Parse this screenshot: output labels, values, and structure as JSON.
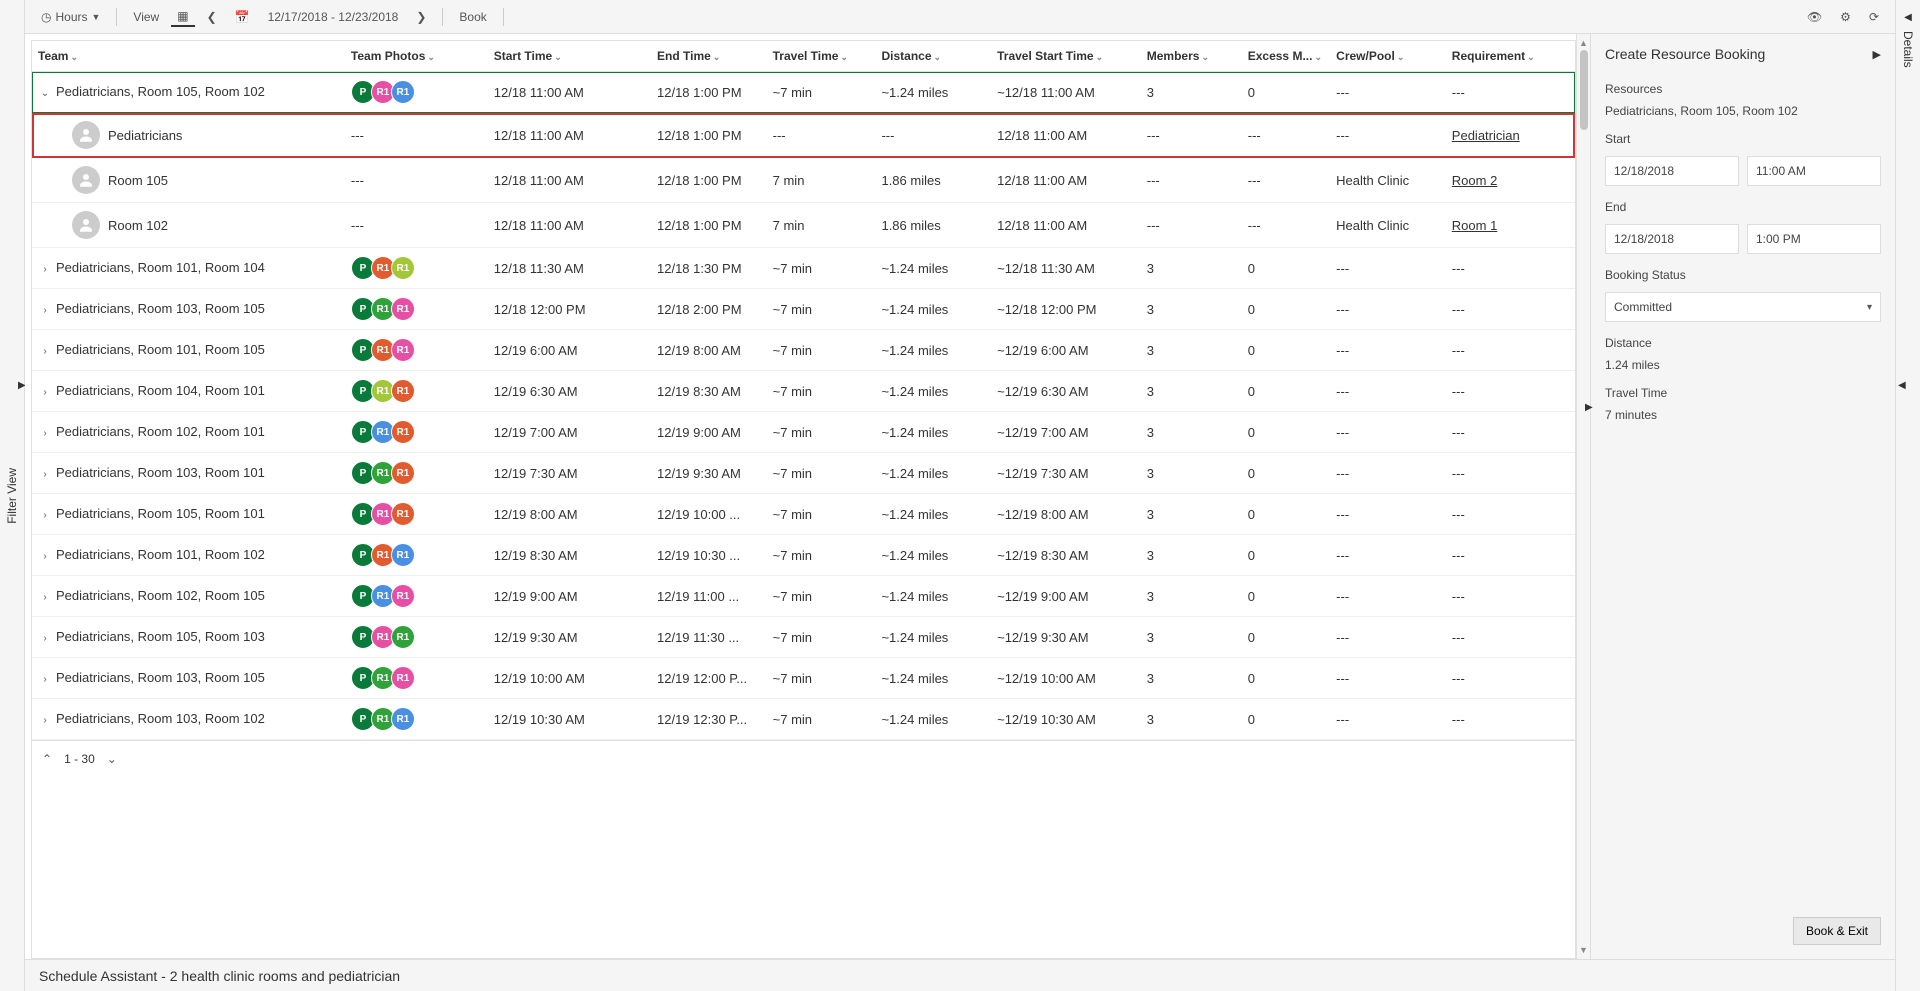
{
  "leftRailLabel": "Filter View",
  "rightRailLabel": "Details",
  "toolbar": {
    "hours": "Hours",
    "view": "View",
    "dateRange": "12/17/2018 - 12/23/2018",
    "book": "Book"
  },
  "columns": {
    "team": "Team",
    "photos": "Team Photos",
    "start": "Start Time",
    "end": "End Time",
    "travel": "Travel Time",
    "distance": "Distance",
    "travelStart": "Travel Start Time",
    "members": "Members",
    "excess": "Excess M...",
    "crew": "Crew/Pool",
    "requirement": "Requirement"
  },
  "rows": [
    {
      "expanded": true,
      "team": "Pediatricians, Room 105, Room 102",
      "photos": [
        {
          "t": "P",
          "c": "p-darkgreen"
        },
        {
          "t": "R1",
          "c": "r-pink"
        },
        {
          "t": "R1",
          "c": "r-blue"
        }
      ],
      "start": "12/18 11:00 AM",
      "end": "12/18 1:00 PM",
      "travel": "~7 min",
      "distance": "~1.24 miles",
      "travelStart": "~12/18 11:00 AM",
      "members": "3",
      "excess": "0",
      "crew": "---",
      "req": "---",
      "selected": true
    },
    {
      "child": true,
      "highlight": true,
      "team": "Pediatricians",
      "start": "12/18 11:00 AM",
      "end": "12/18 1:00 PM",
      "travel": "---",
      "distance": "---",
      "travelStart": "12/18 11:00 AM",
      "members": "---",
      "excess": "---",
      "crew": "---",
      "req": "Pediatrician",
      "reqLink": true,
      "photosText": "---"
    },
    {
      "child": true,
      "team": "Room 105",
      "start": "12/18 11:00 AM",
      "end": "12/18 1:00 PM",
      "travel": "7 min",
      "distance": "1.86 miles",
      "travelStart": "12/18 11:00 AM",
      "members": "---",
      "excess": "---",
      "crew": "Health Clinic",
      "req": "Room 2",
      "reqLink": true,
      "photosText": "---"
    },
    {
      "child": true,
      "team": "Room 102",
      "start": "12/18 11:00 AM",
      "end": "12/18 1:00 PM",
      "travel": "7 min",
      "distance": "1.86 miles",
      "travelStart": "12/18 11:00 AM",
      "members": "---",
      "excess": "---",
      "crew": "Health Clinic",
      "req": "Room 1",
      "reqLink": true,
      "photosText": "---"
    },
    {
      "team": "Pediatricians, Room 101, Room 104",
      "photos": [
        {
          "t": "P",
          "c": "p-darkgreen"
        },
        {
          "t": "R1",
          "c": "r-orange"
        },
        {
          "t": "R1",
          "c": "r-olive"
        }
      ],
      "start": "12/18 11:30 AM",
      "end": "12/18 1:30 PM",
      "travel": "~7 min",
      "distance": "~1.24 miles",
      "travelStart": "~12/18 11:30 AM",
      "members": "3",
      "excess": "0",
      "crew": "---",
      "req": "---"
    },
    {
      "team": "Pediatricians, Room 103, Room 105",
      "photos": [
        {
          "t": "P",
          "c": "p-darkgreen"
        },
        {
          "t": "R1",
          "c": "r-green"
        },
        {
          "t": "R1",
          "c": "r-pink"
        }
      ],
      "start": "12/18 12:00 PM",
      "end": "12/18 2:00 PM",
      "travel": "~7 min",
      "distance": "~1.24 miles",
      "travelStart": "~12/18 12:00 PM",
      "members": "3",
      "excess": "0",
      "crew": "---",
      "req": "---"
    },
    {
      "team": "Pediatricians, Room 101, Room 105",
      "photos": [
        {
          "t": "P",
          "c": "p-darkgreen"
        },
        {
          "t": "R1",
          "c": "r-orange"
        },
        {
          "t": "R1",
          "c": "r-pink"
        }
      ],
      "start": "12/19 6:00 AM",
      "end": "12/19 8:00 AM",
      "travel": "~7 min",
      "distance": "~1.24 miles",
      "travelStart": "~12/19 6:00 AM",
      "members": "3",
      "excess": "0",
      "crew": "---",
      "req": "---"
    },
    {
      "team": "Pediatricians, Room 104, Room 101",
      "photos": [
        {
          "t": "P",
          "c": "p-darkgreen"
        },
        {
          "t": "R1",
          "c": "r-olive"
        },
        {
          "t": "R1",
          "c": "r-orange"
        }
      ],
      "start": "12/19 6:30 AM",
      "end": "12/19 8:30 AM",
      "travel": "~7 min",
      "distance": "~1.24 miles",
      "travelStart": "~12/19 6:30 AM",
      "members": "3",
      "excess": "0",
      "crew": "---",
      "req": "---"
    },
    {
      "team": "Pediatricians, Room 102, Room 101",
      "photos": [
        {
          "t": "P",
          "c": "p-darkgreen"
        },
        {
          "t": "R1",
          "c": "r-blue"
        },
        {
          "t": "R1",
          "c": "r-orange"
        }
      ],
      "start": "12/19 7:00 AM",
      "end": "12/19 9:00 AM",
      "travel": "~7 min",
      "distance": "~1.24 miles",
      "travelStart": "~12/19 7:00 AM",
      "members": "3",
      "excess": "0",
      "crew": "---",
      "req": "---"
    },
    {
      "team": "Pediatricians, Room 103, Room 101",
      "photos": [
        {
          "t": "P",
          "c": "p-darkgreen"
        },
        {
          "t": "R1",
          "c": "r-green"
        },
        {
          "t": "R1",
          "c": "r-orange"
        }
      ],
      "start": "12/19 7:30 AM",
      "end": "12/19 9:30 AM",
      "travel": "~7 min",
      "distance": "~1.24 miles",
      "travelStart": "~12/19 7:30 AM",
      "members": "3",
      "excess": "0",
      "crew": "---",
      "req": "---"
    },
    {
      "team": "Pediatricians, Room 105, Room 101",
      "photos": [
        {
          "t": "P",
          "c": "p-darkgreen"
        },
        {
          "t": "R1",
          "c": "r-pink"
        },
        {
          "t": "R1",
          "c": "r-orange"
        }
      ],
      "start": "12/19 8:00 AM",
      "end": "12/19 10:00 ...",
      "travel": "~7 min",
      "distance": "~1.24 miles",
      "travelStart": "~12/19 8:00 AM",
      "members": "3",
      "excess": "0",
      "crew": "---",
      "req": "---"
    },
    {
      "team": "Pediatricians, Room 101, Room 102",
      "photos": [
        {
          "t": "P",
          "c": "p-darkgreen"
        },
        {
          "t": "R1",
          "c": "r-orange"
        },
        {
          "t": "R1",
          "c": "r-blue"
        }
      ],
      "start": "12/19 8:30 AM",
      "end": "12/19 10:30 ...",
      "travel": "~7 min",
      "distance": "~1.24 miles",
      "travelStart": "~12/19 8:30 AM",
      "members": "3",
      "excess": "0",
      "crew": "---",
      "req": "---"
    },
    {
      "team": "Pediatricians, Room 102, Room 105",
      "photos": [
        {
          "t": "P",
          "c": "p-darkgreen"
        },
        {
          "t": "R1",
          "c": "r-blue"
        },
        {
          "t": "R1",
          "c": "r-pink"
        }
      ],
      "start": "12/19 9:00 AM",
      "end": "12/19 11:00 ...",
      "travel": "~7 min",
      "distance": "~1.24 miles",
      "travelStart": "~12/19 9:00 AM",
      "members": "3",
      "excess": "0",
      "crew": "---",
      "req": "---"
    },
    {
      "team": "Pediatricians, Room 105, Room 103",
      "photos": [
        {
          "t": "P",
          "c": "p-darkgreen"
        },
        {
          "t": "R1",
          "c": "r-pink"
        },
        {
          "t": "R1",
          "c": "r-green"
        }
      ],
      "start": "12/19 9:30 AM",
      "end": "12/19 11:30 ...",
      "travel": "~7 min",
      "distance": "~1.24 miles",
      "travelStart": "~12/19 9:30 AM",
      "members": "3",
      "excess": "0",
      "crew": "---",
      "req": "---"
    },
    {
      "team": "Pediatricians, Room 103, Room 105",
      "photos": [
        {
          "t": "P",
          "c": "p-darkgreen"
        },
        {
          "t": "R1",
          "c": "r-green"
        },
        {
          "t": "R1",
          "c": "r-pink"
        }
      ],
      "start": "12/19 10:00 AM",
      "end": "12/19 12:00 P...",
      "travel": "~7 min",
      "distance": "~1.24 miles",
      "travelStart": "~12/19 10:00 AM",
      "members": "3",
      "excess": "0",
      "crew": "---",
      "req": "---"
    },
    {
      "team": "Pediatricians, Room 103, Room 102",
      "photos": [
        {
          "t": "P",
          "c": "p-darkgreen"
        },
        {
          "t": "R1",
          "c": "r-green"
        },
        {
          "t": "R1",
          "c": "r-blue"
        }
      ],
      "start": "12/19 10:30 AM",
      "end": "12/19 12:30 P...",
      "travel": "~7 min",
      "distance": "~1.24 miles",
      "travelStart": "~12/19 10:30 AM",
      "members": "3",
      "excess": "0",
      "crew": "---",
      "req": "---"
    }
  ],
  "paginator": {
    "range": "1 - 30"
  },
  "caption": "Schedule Assistant - 2 health clinic rooms and pediatrician",
  "sidePanel": {
    "title": "Create Resource Booking",
    "resourcesLabel": "Resources",
    "resourcesValue": "Pediatricians, Room 105, Room 102",
    "startLabel": "Start",
    "startDate": "12/18/2018",
    "startTime": "11:00 AM",
    "endLabel": "End",
    "endDate": "12/18/2018",
    "endTime": "1:00 PM",
    "statusLabel": "Booking Status",
    "statusValue": "Committed",
    "distanceLabel": "Distance",
    "distanceValue": "1.24 miles",
    "travelLabel": "Travel Time",
    "travelValue": "7 minutes",
    "bookBtn": "Book & Exit"
  }
}
